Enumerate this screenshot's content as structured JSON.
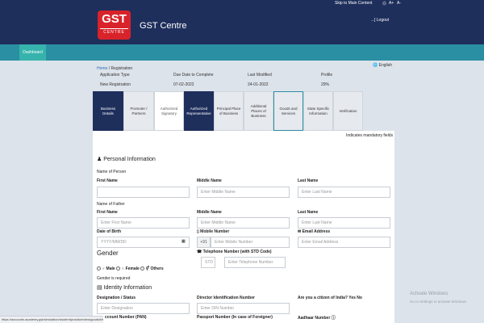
{
  "topbar": {
    "skip_link": "Skip to Main Content",
    "help": "⓪",
    "font_bigger": "A+",
    "font_smaller": "A-"
  },
  "header": {
    "logo_top": "GST",
    "logo_bottom": "CENTRE",
    "brand": "GST Centre",
    "logout": "→] Logout"
  },
  "nav": {
    "dashboard": "Dashboard"
  },
  "language": "🌐 English",
  "breadcrumb": {
    "home": "Home",
    "sep": " / ",
    "current": "Registration"
  },
  "summary": {
    "headers": [
      "Application Type",
      "Due Date to Complete",
      "Last Modified",
      "Profile"
    ],
    "values": [
      "New Registration",
      "07-02-2022",
      "24-01-2022",
      "29%"
    ]
  },
  "tabs": [
    "Business Details",
    "Promoter / Partners",
    "Authorized Signatory",
    "Authorized Representative",
    "Principal Place of Business",
    "Additional Places of Business",
    "Goods and Services",
    "State Specific Information",
    "Verification"
  ],
  "mandatory_note": "Indicates mandatory fields",
  "personal": {
    "title": "Personal Information",
    "name_of_person": "Name of Person",
    "name_of_father": "Name of Father",
    "first_name": "First Name",
    "middle_name": "Middle Name",
    "last_name": "Last Name",
    "ph_first": "Enter First Name",
    "ph_middle": "Enter Middle Name",
    "ph_last": "Enter Last Name",
    "dob": "Date of Birth",
    "dob_ph": "YYYY/MM/DD",
    "mobile": "Mobile Number",
    "mobile_prefix": "+91",
    "mobile_ph": "Enter Mobile Number",
    "email": "Email Address",
    "email_ph": "Enter Email Address",
    "gender": "Gender",
    "telephone": "Telephone Number (with STD Code)",
    "std_ph": "STD",
    "tel_ph": "Enter Telephone Number",
    "male": "Male",
    "female": "Female",
    "others": "Others",
    "gender_required": "Gender is required"
  },
  "identity": {
    "title": "Identity Information",
    "designation": "Designation / Status",
    "designation_ph": "Enter Designation",
    "din": "Director Identification Number",
    "din_ph": "Enter DIN Number",
    "citizen": "Are you a citizen of India?",
    "citizen_no": "Yes No",
    "pan": "ccount Number (PAN)",
    "passport": "Passport Number (In case of Foreigner)",
    "aadhaar": "Aadhaar Number"
  },
  "status_url": "https://accounts.academy.gst/simulation/student/practice/view/goods/f/ex340/p3/aa/96",
  "watermark": {
    "line1": "Activate Windows",
    "line2": "Go to Settings to activate Windows."
  },
  "colors": {
    "dark_navy": "#1f2f5c",
    "teal": "#2b8fa3",
    "red": "#d8232a"
  }
}
